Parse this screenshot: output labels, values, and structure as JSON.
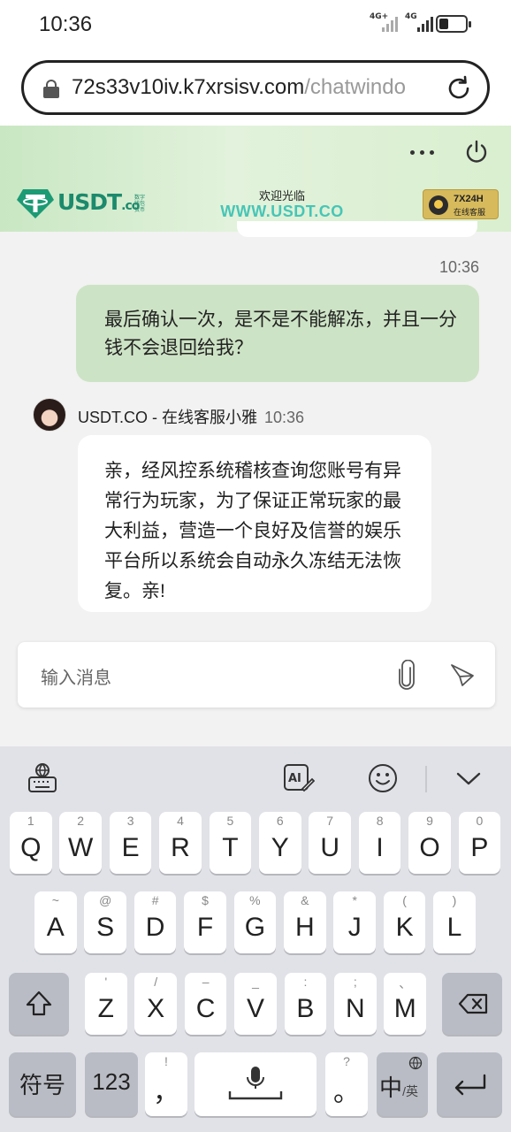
{
  "status_bar": {
    "time": "10:36",
    "signal1_label": "4G+",
    "signal2_label": "4G"
  },
  "browser": {
    "url_main": "72s33v10iv.k7xrsisv.com",
    "url_rest": "/chatwindo"
  },
  "chat_header": {
    "logo_word": "USDT",
    "logo_suffix": ".co",
    "logo_sub": "数字 钱包 货币",
    "welcome": "欢迎光临",
    "site": "WWW.USDT.CO",
    "cs_badge_line1": "7X24H",
    "cs_badge_line2": "在线客服"
  },
  "messages": {
    "time_right": "10:36",
    "outgoing_text": "最后确认一次，是不是不能解冻，并且一分钱不会退回给我？",
    "sender_name": "USDT.CO - 在线客服小雅",
    "sender_time": "10:36",
    "incoming_text": "亲，经风控系统稽核查询您账号有异常行为玩家，为了保证正常玩家的最大利益，营造一个良好及信誉的娱乐平台所以系统会自动永久冻结无法恢复。亲!"
  },
  "input": {
    "placeholder": "输入消息"
  },
  "keyboard": {
    "row1": [
      {
        "hint": "1",
        "key": "Q"
      },
      {
        "hint": "2",
        "key": "W"
      },
      {
        "hint": "3",
        "key": "E"
      },
      {
        "hint": "4",
        "key": "R"
      },
      {
        "hint": "5",
        "key": "T"
      },
      {
        "hint": "6",
        "key": "Y"
      },
      {
        "hint": "7",
        "key": "U"
      },
      {
        "hint": "8",
        "key": "I"
      },
      {
        "hint": "9",
        "key": "O"
      },
      {
        "hint": "0",
        "key": "P"
      }
    ],
    "row2": [
      {
        "hint": "~",
        "key": "A"
      },
      {
        "hint": "@",
        "key": "S"
      },
      {
        "hint": "#",
        "key": "D"
      },
      {
        "hint": "$",
        "key": "F"
      },
      {
        "hint": "%",
        "key": "G"
      },
      {
        "hint": "&",
        "key": "H"
      },
      {
        "hint": "*",
        "key": "J"
      },
      {
        "hint": "(",
        "key": "K"
      },
      {
        "hint": ")",
        "key": "L"
      }
    ],
    "row3": [
      {
        "hint": "'",
        "key": "Z"
      },
      {
        "hint": "/",
        "key": "X"
      },
      {
        "hint": "–",
        "key": "C"
      },
      {
        "hint": "_",
        "key": "V"
      },
      {
        "hint": ":",
        "key": "B"
      },
      {
        "hint": ";",
        "key": "N"
      },
      {
        "hint": "、",
        "key": "M"
      }
    ],
    "symbols_label": "符号",
    "numbers_label": "123",
    "comma_hint": "!",
    "comma_label": "，",
    "period_hint": "?",
    "period_label": "。",
    "lang_main": "中",
    "lang_sub": "/英"
  }
}
